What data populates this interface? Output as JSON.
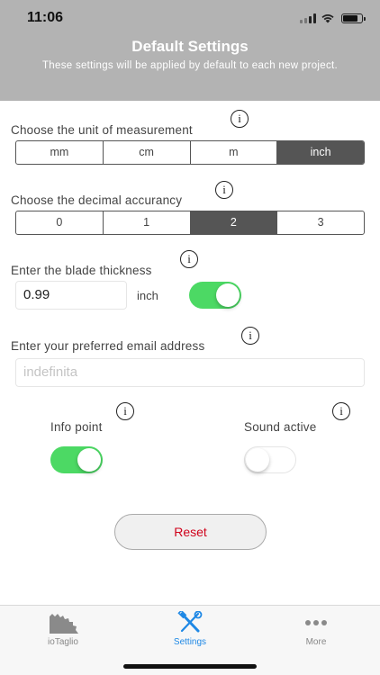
{
  "status": {
    "time": "11:06"
  },
  "header": {
    "title": "Default Settings",
    "subtitle": "These settings will be applied by default to each new project."
  },
  "unit": {
    "label": "Choose the unit of measurement",
    "options": [
      "mm",
      "cm",
      "m",
      "inch"
    ],
    "selected": "inch"
  },
  "decimal": {
    "label": "Choose the decimal accurancy",
    "options": [
      "0",
      "1",
      "2",
      "3"
    ],
    "selected": "2"
  },
  "blade": {
    "label": "Enter the blade thickness",
    "value": "0.99",
    "unit": "inch",
    "toggle_on": true
  },
  "email": {
    "label": "Enter your preferred email address",
    "placeholder": "indefinita"
  },
  "info_point": {
    "label": "Info point",
    "on": true
  },
  "sound": {
    "label": "Sound active",
    "on": false
  },
  "info_glyph": "i",
  "reset_label": "Reset",
  "tabs": [
    {
      "label": "ioTaglio",
      "icon": "saw-blade-icon",
      "active": false
    },
    {
      "label": "Settings",
      "icon": "tools-icon",
      "active": true
    },
    {
      "label": "More",
      "icon": "more-dots-icon",
      "active": false
    }
  ],
  "colors": {
    "header": "#b3b3b3",
    "segment_active": "#555555",
    "toggle_on": "#4cd964",
    "accent": "#1e88e5",
    "reset_text": "#d0021b"
  }
}
